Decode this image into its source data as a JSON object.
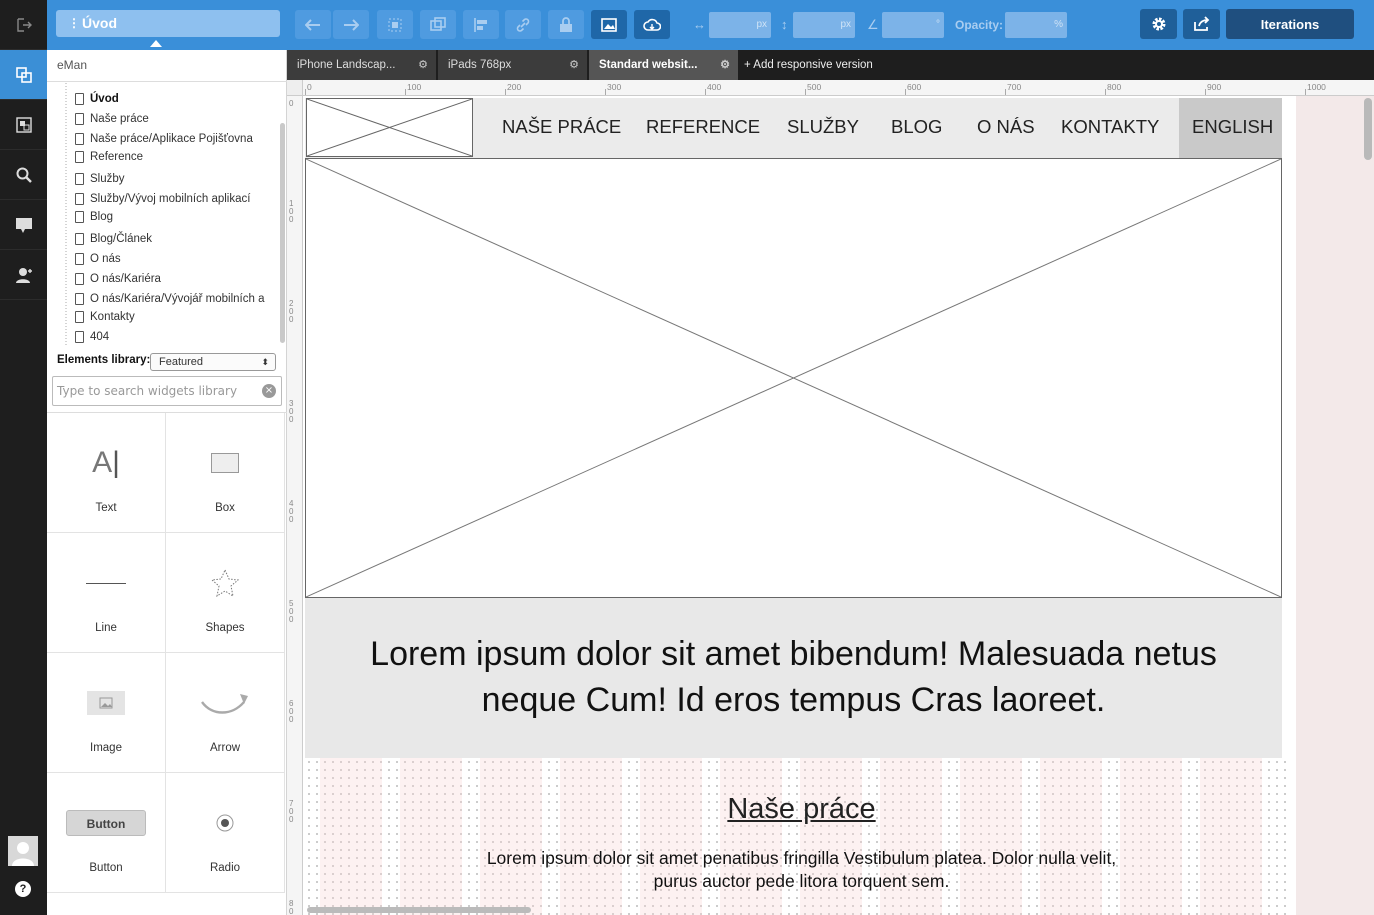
{
  "topbar": {
    "page_title": "Úvod",
    "opacity_label": "Opacity:",
    "unit_px": "px",
    "unit_deg": "°",
    "unit_pct": "%",
    "iterations_label": "Iterations"
  },
  "tabs": [
    {
      "label": "iPhone Landscap..."
    },
    {
      "label": "iPads  768px"
    },
    {
      "label": "Standard websit..."
    }
  ],
  "add_responsive": "+ Add responsive version",
  "sidebar": {
    "project_name": "eMan",
    "pages": [
      "Úvod",
      "Naše práce",
      "Naše práce/Aplikace Pojišťovna",
      "Reference",
      "Služby",
      "Služby/Vývoj mobilních aplikací",
      "Blog",
      "Blog/Článek",
      "O nás",
      "O nás/Kariéra",
      "O nás/Kariéra/Vývojář mobilních a",
      "Kontakty",
      "404"
    ],
    "library_label": "Elements library:",
    "library_selected": "Featured",
    "search_placeholder": "Type to search widgets library",
    "widgets": [
      {
        "label": "Text",
        "icon": "text-icon"
      },
      {
        "label": "Box",
        "icon": "box-icon"
      },
      {
        "label": "Line",
        "icon": "line-icon"
      },
      {
        "label": "Shapes",
        "icon": "star-icon"
      },
      {
        "label": "Image",
        "icon": "image-icon"
      },
      {
        "label": "Arrow",
        "icon": "arrow-icon"
      },
      {
        "label": "Button",
        "icon": "button-icon",
        "preview": "Button"
      },
      {
        "label": "Radio",
        "icon": "radio-icon"
      }
    ]
  },
  "ruler": {
    "top": [
      "0",
      "100",
      "200",
      "300",
      "400",
      "500",
      "600",
      "700",
      "800",
      "900",
      "1000"
    ],
    "left": [
      "0",
      "100",
      "200",
      "300",
      "400",
      "500",
      "600",
      "700",
      "800"
    ]
  },
  "canvas": {
    "nav": [
      "NAŠE PRÁCE",
      "REFERENCE",
      "SLUŽBY",
      "BLOG",
      "O NÁS",
      "KONTAKTY",
      "ENGLISH"
    ],
    "quote": "Lorem ipsum dolor sit amet bibendum! Malesuada netus neque Cum! Id eros tempus Cras laoreet.",
    "section_title": "Naše práce",
    "section_text": "Lorem ipsum dolor sit amet penatibus fringilla Vestibulum platea. Dolor nulla velit, purus auctor pede litora torquent sem."
  },
  "colors": {
    "accent": "#3a8fd9",
    "rail": "#1e1e1e",
    "iterations": "#1f4f7f"
  }
}
